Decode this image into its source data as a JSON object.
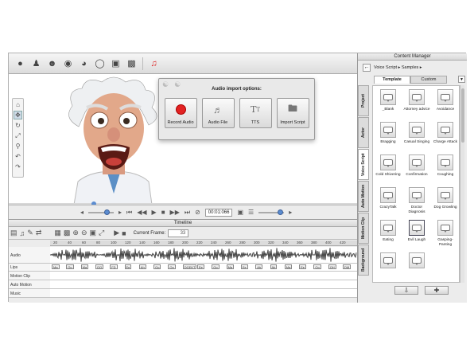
{
  "toolbar": {
    "icons": [
      "user-icon",
      "user-figure-icon",
      "head-icon",
      "eye-icon",
      "lips-icon",
      "portrait-icon",
      "image-icon",
      "audio-record-icon"
    ]
  },
  "popup": {
    "title": "Audio import options:",
    "buttons": [
      {
        "label": "Record Audio"
      },
      {
        "label": "Audio File"
      },
      {
        "label": "TTS"
      },
      {
        "label": "Import Script"
      }
    ]
  },
  "playbar": {
    "time": "00:01:066"
  },
  "timeline": {
    "title": "Timeline",
    "current_frame_label": "Current Frame:",
    "current_frame_value": "33",
    "ruler_ticks": [
      "20",
      "40",
      "60",
      "80",
      "100",
      "120",
      "140",
      "160",
      "180",
      "200",
      "220",
      "240",
      "260",
      "280",
      "300",
      "320",
      "340",
      "360",
      "380",
      "400",
      "420"
    ],
    "tracks": [
      "Audio",
      "Lips",
      "Motion Clip",
      "Auto Motion",
      "Music"
    ],
    "lips": [
      "Ma",
      "Oo",
      "Ma",
      "OO",
      "FD",
      "Ee",
      "Ah",
      "Oo",
      "Oo",
      "DGEKT",
      "Ee",
      "Oo",
      "Ma",
      "Ee",
      "Ah",
      "Ah",
      "Ma",
      "Ee",
      "Oo",
      "OH",
      "DM"
    ]
  },
  "content_manager": {
    "title": "Content Manager",
    "breadcrumb": "Voice Script ▸ Samples ▸",
    "tabs": [
      "Template",
      "Custom"
    ],
    "side_tabs": [
      "Project",
      "Actor",
      "Voice Script",
      "Auto Motion",
      "Motion Clip",
      "Background"
    ],
    "items": [
      "_Blank",
      "Attorney advice",
      "Avoidance",
      "Bragging",
      "Casual Singing",
      "Charge Attack",
      "Cold Shivering",
      "Confirmation",
      "Coughing",
      "CrazyTalk",
      "Doctor Diagnosis",
      "Dog Growling",
      "Eating",
      "Evil Laugh",
      "Gasping-Panting",
      "",
      ""
    ]
  },
  "colors": {
    "accent": "#5b8cd0",
    "record": "#e22222"
  }
}
